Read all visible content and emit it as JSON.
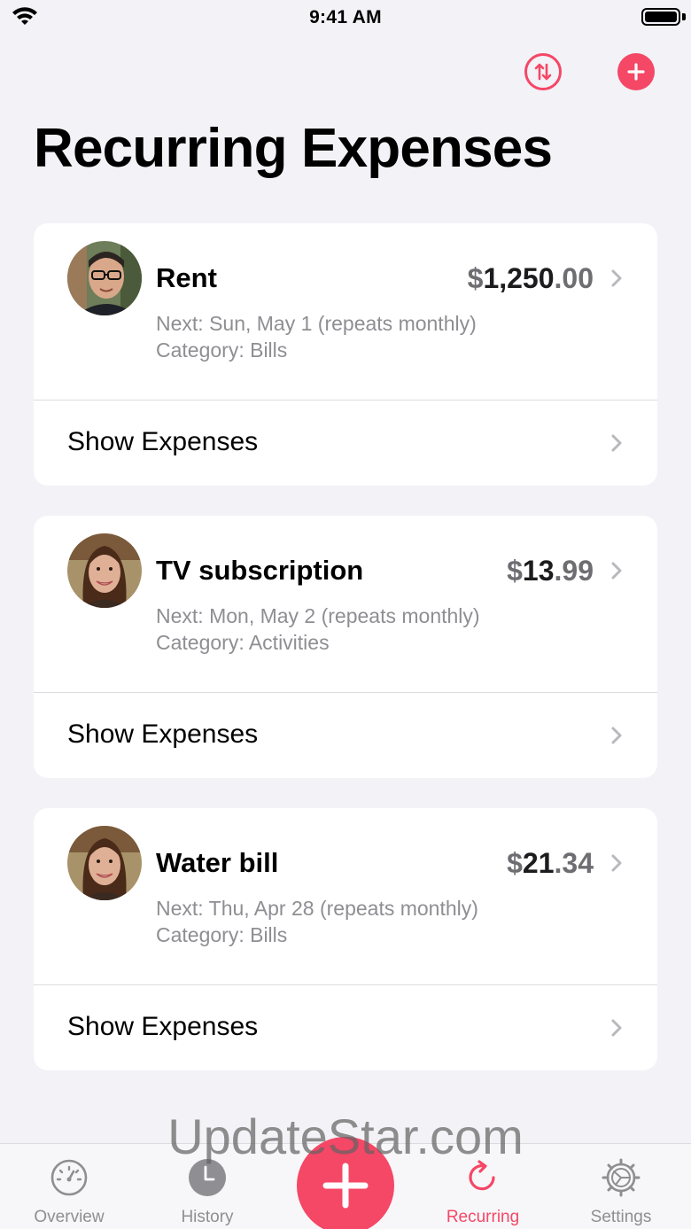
{
  "status_bar": {
    "time": "9:41 AM"
  },
  "page": {
    "title": "Recurring Expenses"
  },
  "toolbar": {
    "sort_icon": "sort-arrows-icon",
    "add_icon": "plus-circle-icon"
  },
  "expenses": [
    {
      "name": "Rent",
      "amount_currency": "$",
      "amount_whole": "1,250",
      "amount_cents": ".00",
      "next": "Next: Sun, May 1 (repeats monthly)",
      "category": "Category: Bills",
      "show_label": "Show Expenses",
      "avatar": "man-with-glasses"
    },
    {
      "name": "TV subscription",
      "amount_currency": "$",
      "amount_whole": "13",
      "amount_cents": ".99",
      "next": "Next: Mon, May 2 (repeats monthly)",
      "category": "Category: Activities",
      "show_label": "Show Expenses",
      "avatar": "woman-smiling"
    },
    {
      "name": "Water bill",
      "amount_currency": "$",
      "amount_whole": "21",
      "amount_cents": ".34",
      "next": "Next: Thu, Apr 28 (repeats monthly)",
      "category": "Category: Bills",
      "show_label": "Show Expenses",
      "avatar": "woman-smiling"
    }
  ],
  "watermark": "UpdateStar.com",
  "tabs": [
    {
      "label": "Overview",
      "icon": "gauge-icon",
      "active": false
    },
    {
      "label": "History",
      "icon": "clock-icon",
      "active": false
    },
    {
      "label": "Recurring",
      "icon": "refresh-icon",
      "active": true
    },
    {
      "label": "Settings",
      "icon": "gear-icon",
      "active": false
    }
  ],
  "colors": {
    "accent": "#f54766",
    "background": "#f2f2f7",
    "secondary_text": "#8e8e93"
  }
}
